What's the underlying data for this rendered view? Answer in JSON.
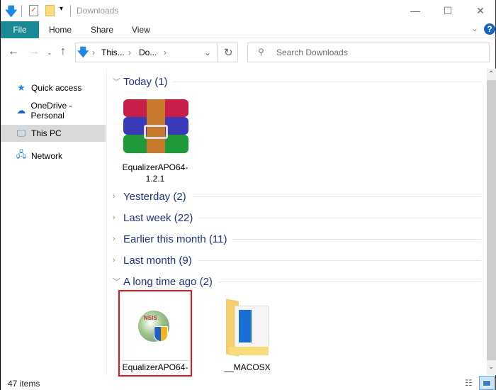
{
  "window": {
    "title": "Downloads",
    "minimize": "—",
    "maximize": "☐",
    "close": "✕"
  },
  "ribbon": {
    "tabs": [
      "File",
      "Home",
      "Share",
      "View"
    ],
    "help": "?",
    "expand": "⌄"
  },
  "address": {
    "crumbs": [
      "This...",
      "Do..."
    ]
  },
  "search": {
    "placeholder": "Search Downloads"
  },
  "nav": {
    "items": [
      {
        "label": "Quick access",
        "icon": "star-icon"
      },
      {
        "label": "OneDrive - Personal",
        "icon": "cloud-icon"
      },
      {
        "label": "This PC",
        "icon": "computer-icon"
      },
      {
        "label": "Network",
        "icon": "network-icon"
      }
    ]
  },
  "groups": [
    {
      "label": "Today (1)",
      "expanded": true
    },
    {
      "label": "Yesterday (2)",
      "expanded": false
    },
    {
      "label": "Last week (22)",
      "expanded": false
    },
    {
      "label": "Earlier this month (11)",
      "expanded": false
    },
    {
      "label": "Last month (9)",
      "expanded": false
    },
    {
      "label": "A long time ago (2)",
      "expanded": true
    }
  ],
  "files": {
    "today": [
      {
        "name1": "EqualizerAPO64-",
        "name2": "1.2.1",
        "icon": "winrar-archive-icon"
      }
    ],
    "old": [
      {
        "name": "EqualizerAPO64-",
        "icon": "installer-icon",
        "highlight_color": "#e8141c"
      },
      {
        "name": "__MACOSX",
        "icon": "folder-icon"
      }
    ]
  },
  "status": {
    "count": "47 items"
  }
}
